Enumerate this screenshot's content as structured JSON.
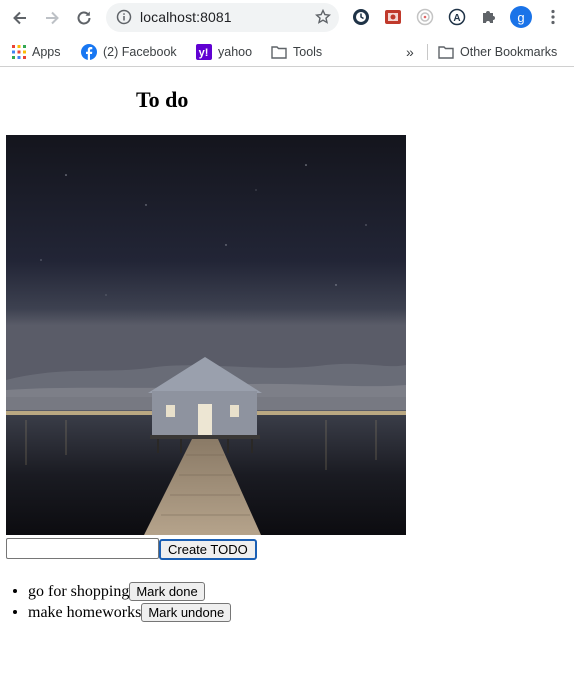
{
  "browser": {
    "url": "localhost:8081",
    "profile_initial": "g",
    "bookmarks": [
      {
        "label": "Apps",
        "icon": "apps-grid-icon"
      },
      {
        "label": "(2) Facebook",
        "icon": "facebook-icon"
      },
      {
        "label": "yahoo",
        "icon": "yahoo-icon"
      },
      {
        "label": "Tools",
        "icon": "folder-icon"
      }
    ],
    "overflow_label": "»",
    "other_bookmarks": "Other Bookmarks"
  },
  "page": {
    "title": "To do",
    "photo_alt": "boathouse-pier-night-photo",
    "input": {
      "value": "",
      "placeholder": ""
    },
    "create_label": "Create TODO",
    "todos": [
      {
        "text": "go for shopping",
        "button": "Mark done"
      },
      {
        "text": "make homeworks",
        "button": "Mark undone"
      }
    ]
  }
}
